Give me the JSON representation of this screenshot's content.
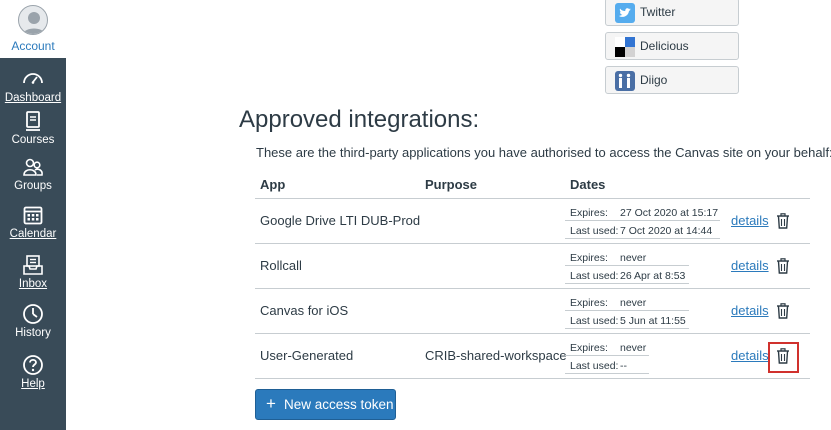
{
  "sidebar": {
    "account_label": "Account",
    "items": [
      {
        "label": "Dashboard",
        "icon": "dashboard-icon"
      },
      {
        "label": "Courses",
        "icon": "courses-icon"
      },
      {
        "label": "Groups",
        "icon": "groups-icon"
      },
      {
        "label": "Calendar",
        "icon": "calendar-icon"
      },
      {
        "label": "Inbox",
        "icon": "inbox-icon"
      },
      {
        "label": "History",
        "icon": "history-icon"
      },
      {
        "label": "Help",
        "icon": "help-icon"
      }
    ]
  },
  "share": {
    "twitter": "Twitter",
    "delicious": "Delicious",
    "diigo": "Diigo"
  },
  "integrations": {
    "title": "Approved integrations:",
    "description": "These are the third-party applications you have authorised to access the Canvas site on your behalf:",
    "columns": {
      "app": "App",
      "purpose": "Purpose",
      "dates": "Dates"
    },
    "expires_label": "Expires:",
    "last_used_label": "Last used:",
    "details_label": "details",
    "rows": [
      {
        "app": "Google Drive LTI DUB-Prod",
        "purpose": "",
        "expires": "27 Oct 2020 at 15:17",
        "last_used": "7 Oct 2020 at 14:44"
      },
      {
        "app": "Rollcall",
        "purpose": "",
        "expires": "never",
        "last_used": "26 Apr at 8:53"
      },
      {
        "app": "Canvas for iOS",
        "purpose": "",
        "expires": "never",
        "last_used": "5 Jun at 11:55"
      },
      {
        "app": "User-Generated",
        "purpose": "CRIB-shared-workspace",
        "expires": "never",
        "last_used": "--"
      }
    ],
    "new_token_label": "New access token"
  },
  "colors": {
    "nav_bg": "#394b58",
    "link": "#2b7abc",
    "primary_button": "#2b7abc",
    "highlight": "#d0312d"
  }
}
